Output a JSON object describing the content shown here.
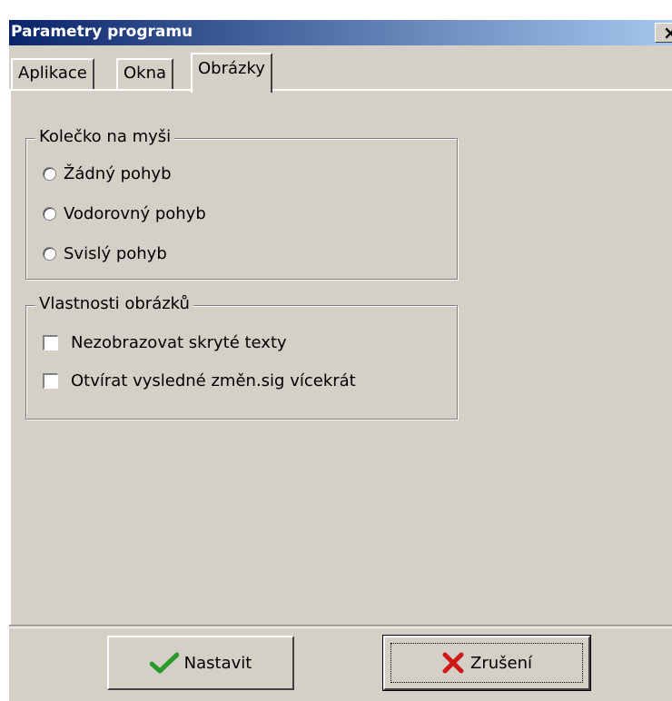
{
  "window": {
    "title": "Parametry programu",
    "close_glyph": "×"
  },
  "tabs": [
    {
      "label": "Aplikace",
      "active": false
    },
    {
      "label": "Okna",
      "active": false
    },
    {
      "label": "Obrázky",
      "active": true
    }
  ],
  "mouse_wheel_group": {
    "title": "Kolečko na myši",
    "options": [
      {
        "label": "Žádný pohyb",
        "selected": false
      },
      {
        "label": "Vodorovný pohyb",
        "selected": false
      },
      {
        "label": "Svislý pohyb",
        "selected": false
      }
    ]
  },
  "image_props_group": {
    "title": "Vlastnosti obrázků",
    "checkboxes": [
      {
        "label": "Nezobrazovat skryté texty",
        "checked": false
      },
      {
        "label": "Otvírat vysledné změn.sig vícekrát",
        "checked": false
      }
    ]
  },
  "buttons": {
    "ok_label": "Nastavit",
    "ok_icon": "checkmark-icon",
    "cancel_label": "Zrušení",
    "cancel_icon": "red-x-icon"
  },
  "colors": {
    "face": "#d4d0c8",
    "titlebar_start": "#0a246a",
    "titlebar_end": "#a6caf0",
    "check_green": "#2a9a2a",
    "cancel_red": "#d01818"
  }
}
